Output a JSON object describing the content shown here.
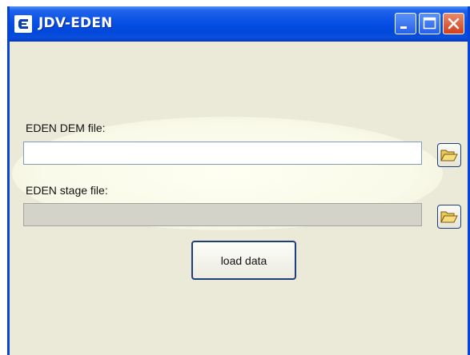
{
  "window": {
    "title": "JDV-EDEN",
    "controls": {
      "minimize": "minimize-icon",
      "maximize": "maximize-icon",
      "close": "close-icon"
    },
    "icon": "app-e-icon"
  },
  "form": {
    "dem_label": "EDEN DEM file:",
    "dem_value": "",
    "stage_label": "EDEN stage file:",
    "stage_value": "",
    "browse_icon": "folder-open-icon",
    "load_button": "load data"
  },
  "colors": {
    "titlebar": "#0a52e6",
    "window_bg": "#ebe9d8",
    "highlight": "#fefef2",
    "close_button": "#d0401a"
  }
}
